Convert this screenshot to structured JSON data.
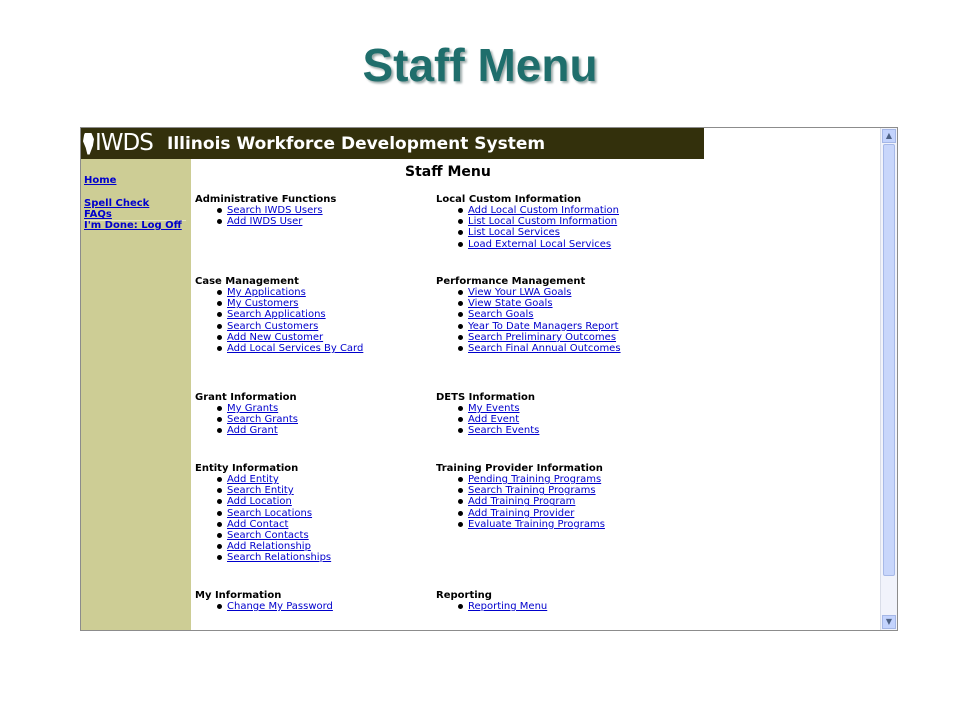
{
  "slide": {
    "title": "Staff Menu"
  },
  "banner": {
    "logo_text": "IWDS",
    "title": "Illinois Workforce Development System"
  },
  "leftnav": {
    "home": "Home",
    "spell_check": "Spell Check",
    "faqs": "FAQs",
    "log_off": "I'm Done: Log Off"
  },
  "content": {
    "title": "Staff Menu",
    "sections": [
      {
        "heading": "Administrative Functions",
        "links": [
          "Search IWDS Users",
          "Add IWDS User"
        ]
      },
      {
        "heading": "Local Custom Information",
        "links": [
          "Add Local Custom Information",
          "List Local Custom Information",
          "List Local Services",
          "Load External Local Services"
        ]
      },
      {
        "heading": "Case Management",
        "links": [
          "My Applications",
          "My Customers",
          "Search Applications",
          "Search Customers",
          "Add New Customer",
          "Add Local Services By Card"
        ]
      },
      {
        "heading": "Performance Management",
        "links": [
          "View Your LWA Goals",
          "View State Goals",
          "Search Goals",
          "Year To Date Managers Report",
          "Search Preliminary Outcomes",
          "Search Final Annual Outcomes"
        ]
      },
      {
        "heading": "Grant Information",
        "links": [
          "My Grants",
          "Search Grants",
          "Add Grant"
        ]
      },
      {
        "heading": "DETS Information",
        "links": [
          "My Events",
          "Add Event",
          "Search Events"
        ]
      },
      {
        "heading": "Entity Information",
        "links": [
          "Add Entity",
          "Search Entity",
          "Add Location",
          "Search Locations",
          "Add Contact",
          "Search Contacts",
          "Add Relationship",
          "Search Relationships"
        ]
      },
      {
        "heading": "Training Provider Information",
        "links": [
          "Pending Training Programs",
          "Search Training Programs",
          "Add Training Program",
          "Add Training Provider",
          "Evaluate Training Programs"
        ]
      },
      {
        "heading": "My Information",
        "links": [
          "Change My Password"
        ]
      },
      {
        "heading": "Reporting",
        "links": [
          "Reporting Menu"
        ]
      }
    ]
  },
  "scrollbar": {
    "up_icon": "arrow-up-icon",
    "down_icon": "arrow-down-icon"
  }
}
